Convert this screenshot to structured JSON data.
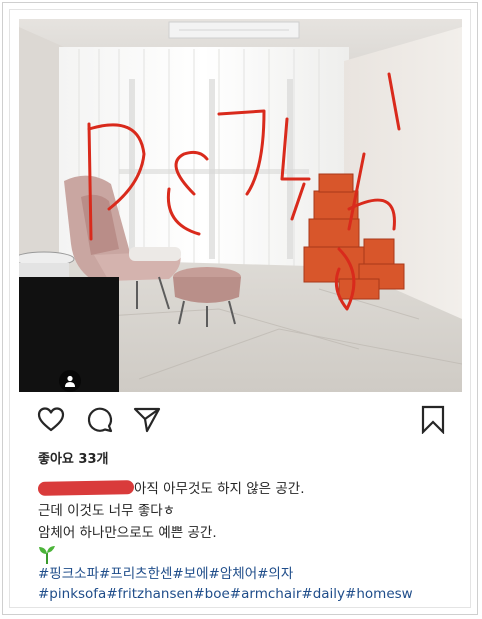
{
  "post": {
    "likes_label": "좋아요 33개",
    "caption_lines": [
      "아직 아무것도 하지 않은 공간.",
      "근데 이것도 너무 좋다ㅎ",
      "암체어 하나만으로도 예쁜 공간."
    ],
    "hashtags_korean": "#핑크소파#프리츠한센#보에#암체어#의자",
    "hashtags_english": "#pinksofa#fritzhansen#boe#armchair#daily#homesw",
    "icons": {
      "like": "heart-icon",
      "comment": "comment-icon",
      "share": "send-icon",
      "save": "bookmark-icon",
      "user_tag": "person-icon",
      "emoji": "sprout-icon"
    }
  },
  "colors": {
    "text": "#262626",
    "hashtag": "#1f4d8a",
    "scribble": "#d92a1c",
    "redaction": "#d93b3b"
  }
}
